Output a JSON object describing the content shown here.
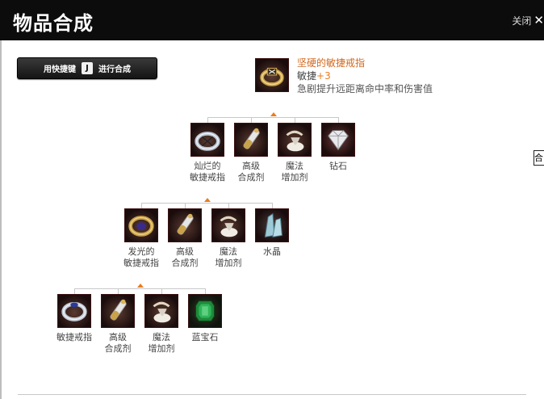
{
  "window": {
    "title": "物品合成",
    "close_label": "关闭",
    "close_icon": "close-x"
  },
  "shortcut": {
    "prefix": "用快捷键",
    "key": "J",
    "suffix": "进行合成"
  },
  "result": {
    "name": "坚硬的敏捷戒指",
    "stat_label": "敏捷",
    "stat_value": "+3",
    "description": "急剧提升远距离命中率和伤害值",
    "icon": "gold-ring"
  },
  "tiers": [
    {
      "items": [
        {
          "label": [
            "灿烂的",
            "敏捷戒指"
          ],
          "icon": "silver-ring"
        },
        {
          "label": [
            "高级",
            "合成剂"
          ],
          "icon": "potion-vial"
        },
        {
          "label": [
            "魔法",
            "增加剂"
          ],
          "icon": "magic-powder"
        },
        {
          "label": [
            "钻石"
          ],
          "icon": "diamond"
        }
      ]
    },
    {
      "items": [
        {
          "label": [
            "发光的",
            "敏捷戒指"
          ],
          "icon": "gold-blue-ring"
        },
        {
          "label": [
            "高级",
            "合成剂"
          ],
          "icon": "potion-vial"
        },
        {
          "label": [
            "魔法",
            "增加剂"
          ],
          "icon": "magic-powder"
        },
        {
          "label": [
            "水晶"
          ],
          "icon": "crystal"
        }
      ]
    },
    {
      "items": [
        {
          "label": [
            "敏捷戒指"
          ],
          "icon": "silver-blue-ring"
        },
        {
          "label": [
            "高级",
            "合成剂"
          ],
          "icon": "potion-vial"
        },
        {
          "label": [
            "魔法",
            "增加剂"
          ],
          "icon": "magic-powder"
        },
        {
          "label": [
            "蓝宝石"
          ],
          "icon": "sapphire"
        }
      ]
    }
  ],
  "side_tab": "合",
  "colors": {
    "title_bar": "#0c0c0c",
    "accent": "#e67e22",
    "item_name": "#d2691e"
  }
}
